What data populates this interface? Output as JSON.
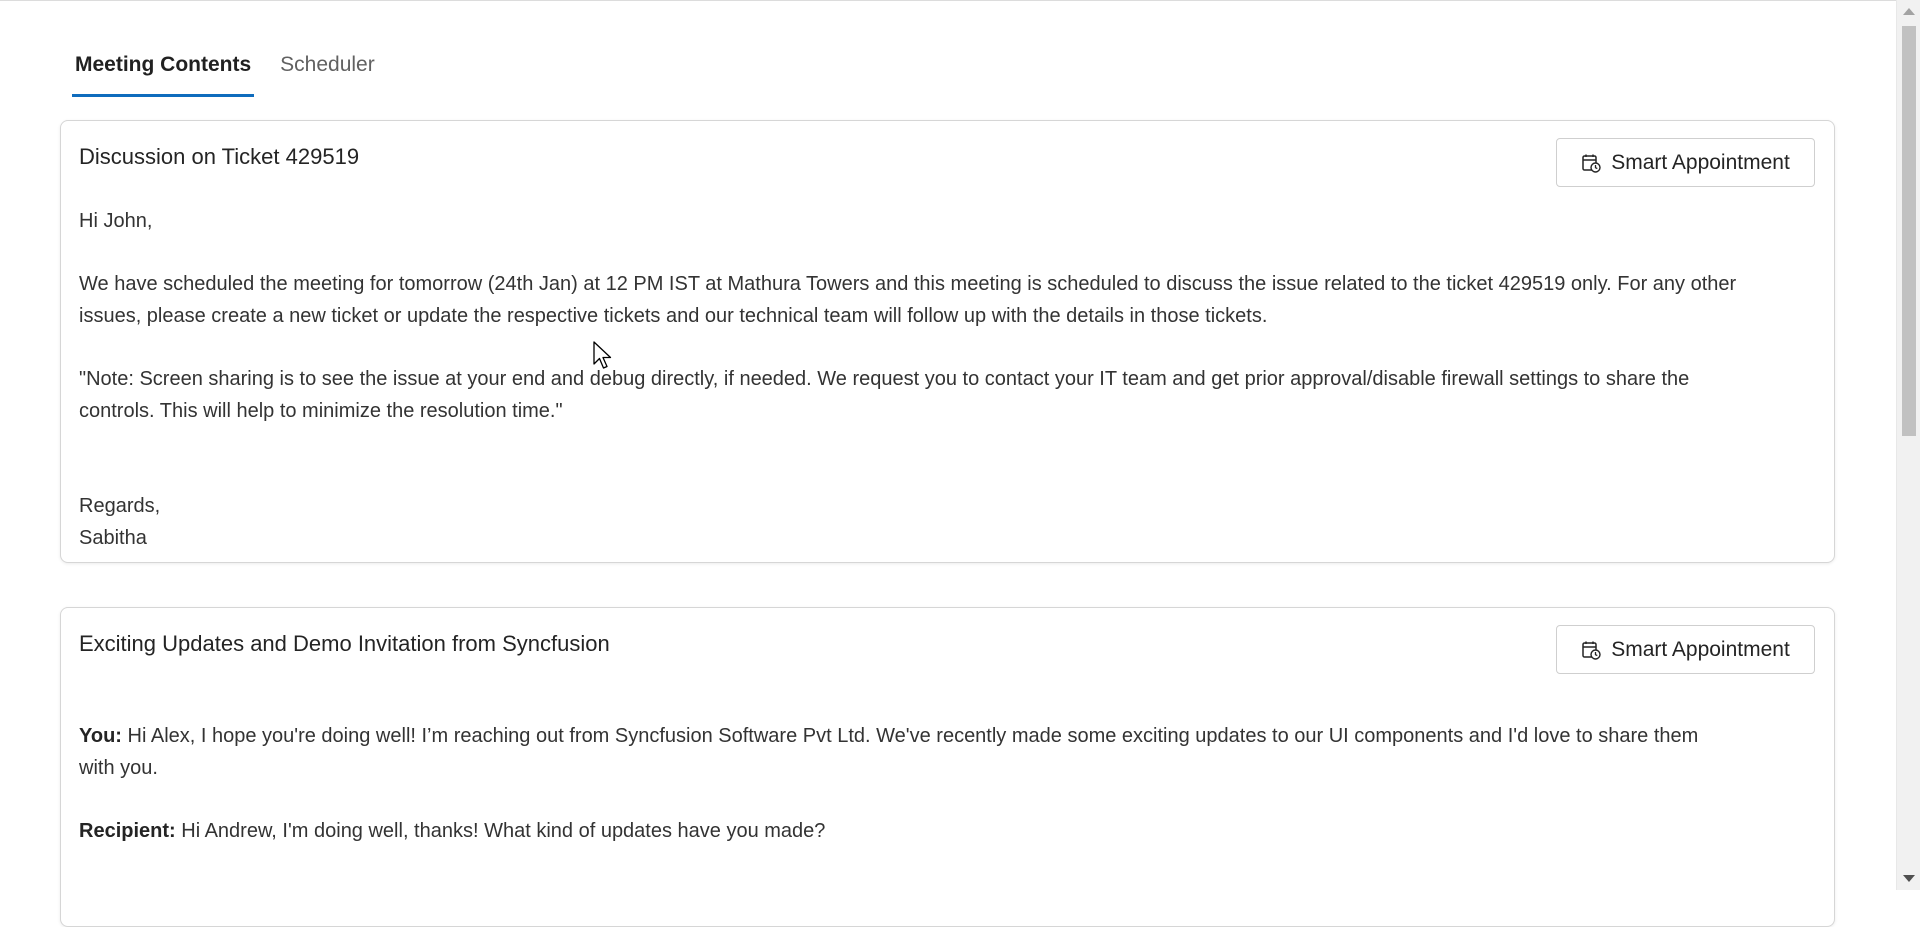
{
  "tabs": [
    {
      "label": "Meeting Contents",
      "active": true
    },
    {
      "label": "Scheduler",
      "active": false
    }
  ],
  "cards": [
    {
      "title": "Discussion on Ticket 429519",
      "button_label": "Smart Appointment",
      "greeting": "Hi John,",
      "paragraph1_line1": "We have scheduled the meeting for tomorrow (24th Jan) at 12 PM IST at Mathura Towers and this meeting is scheduled to discuss the issue related to the ticket 429519 only. For any other",
      "paragraph1_line2": "issues, please create a new ticket or update the respective tickets and our technical team will follow up with the details in those tickets.",
      "paragraph2_line1": "\"Note: Screen sharing is to see the issue at your end and debug directly, if needed. We request you to contact your IT team and get prior approval/disable firewall settings to share the",
      "paragraph2_line2": "controls. This will help to minimize the resolution time.\"",
      "closing": "Regards,",
      "signature": "Sabitha"
    },
    {
      "title": "Exciting Updates and Demo Invitation from Syncfusion",
      "button_label": "Smart Appointment",
      "msg1_speaker": "You:",
      "msg1_line1": " Hi Alex, I hope you're doing well! I’m reaching out from Syncfusion Software Pvt Ltd. We've recently made some exciting updates to our UI components and I'd love to share them",
      "msg1_line2": "with you.",
      "msg2_speaker": "Recipient:",
      "msg2_text": " Hi Andrew, I'm doing well, thanks! What kind of updates have you made?"
    }
  ],
  "icons": {
    "smart_appointment": "calendar-clock-icon",
    "cursor": "mouse-pointer-icon"
  },
  "colors": {
    "accent": "#0f6cbd",
    "border": "#d6d6d6",
    "text": "#333333"
  }
}
